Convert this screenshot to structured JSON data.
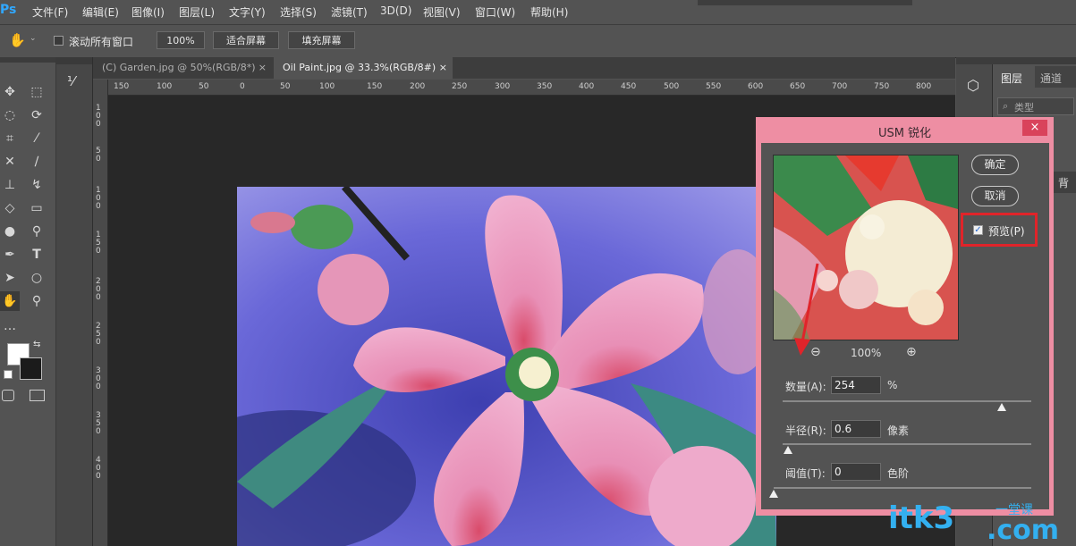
{
  "app": {
    "logo": "Ps"
  },
  "menu": [
    "文件(F)",
    "编辑(E)",
    "图像(I)",
    "图层(L)",
    "文字(Y)",
    "选择(S)",
    "滤镜(T)",
    "3D(D)",
    "视图(V)",
    "窗口(W)",
    "帮助(H)"
  ],
  "options": {
    "scroll_all_label": "滚动所有窗口",
    "zoom_value": "100%",
    "fit_screen": "适合屏幕",
    "fill_screen": "填充屏幕"
  },
  "tabs": [
    {
      "label": "(C) Garden.jpg @ 50%(RGB/8*)",
      "close": "×"
    },
    {
      "label": "Oil Paint.jpg @ 33.3%(RGB/8#)",
      "close": "×"
    }
  ],
  "ruler_h": [
    "150",
    "100",
    "50",
    "0",
    "50",
    "100",
    "150",
    "200",
    "250",
    "300",
    "350",
    "400",
    "450",
    "500",
    "550",
    "600",
    "650",
    "700",
    "750",
    "800"
  ],
  "ruler_v": [
    "1\n0\n0",
    "5\n0",
    "1\n0\n0",
    "1\n5\n0",
    "2\n0\n0",
    "2\n5\n0",
    "3\n0\n0",
    "3\n5\n0",
    "4\n0\n0"
  ],
  "right_panel": {
    "tab_layers": "图层",
    "tab_channels": "通道",
    "search_placeholder": "类型",
    "layer_name_partial": "背"
  },
  "dialog": {
    "title": "USM 锐化",
    "close": "×",
    "ok": "确定",
    "cancel": "取消",
    "preview_label": "预览(P)",
    "preview_checked": true,
    "zoom_percent": "100%",
    "amount": {
      "label": "数量(A):",
      "value": "254",
      "unit": "%",
      "level": 0.88
    },
    "radius": {
      "label": "半径(R):",
      "value": "0.6",
      "unit": "像素",
      "level": 0.02
    },
    "threshold": {
      "label": "阈值(T):",
      "value": "0",
      "unit": "色阶",
      "level": 0.0
    }
  },
  "watermark": {
    "main": "itk3",
    "sub": ".com",
    "cn": "一堂课"
  },
  "colors": {
    "accent": "#31a8ff",
    "dialog_frame": "#ee8ea3",
    "highlight_box": "#e0242a"
  }
}
